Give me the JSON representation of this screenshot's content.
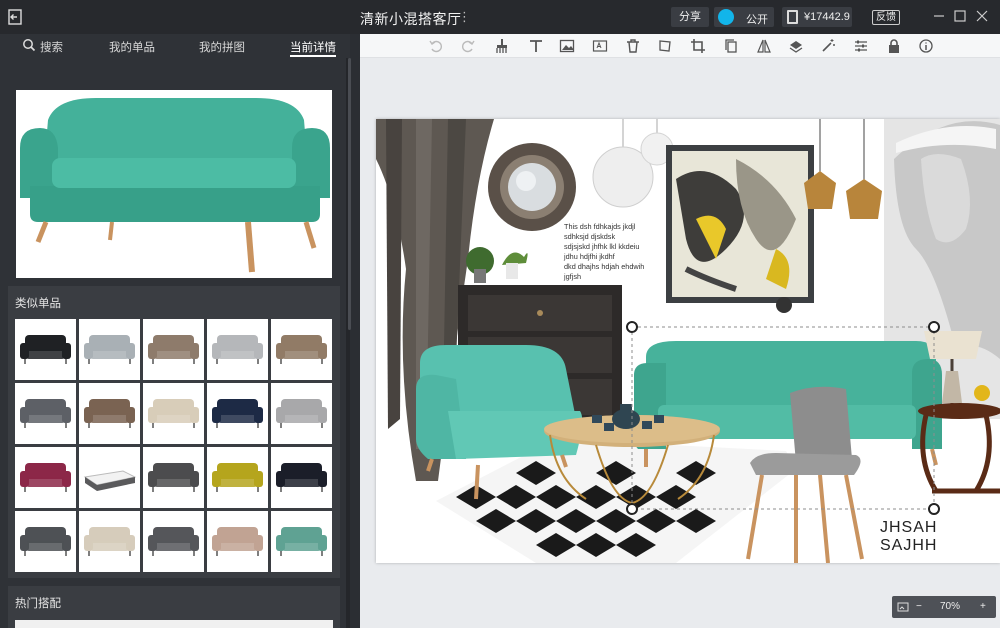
{
  "window": {
    "title": "清新小混搭客厅",
    "more_label": "⋮",
    "share_label": "分享",
    "public_label": "公开",
    "price": "¥17442.9",
    "feedback_label": "反馈"
  },
  "left_panel": {
    "tabs": [
      {
        "label": "搜索",
        "active": false
      },
      {
        "label": "我的单品",
        "active": false
      },
      {
        "label": "我的拼图",
        "active": false
      },
      {
        "label": "当前详情",
        "active": true
      }
    ],
    "similar": {
      "title": "类似单品",
      "items": [
        {
          "icon": "sofa-icon",
          "color": "#1f2124"
        },
        {
          "icon": "sofa-icon",
          "color": "#a9b0b5"
        },
        {
          "icon": "sofa-icon",
          "color": "#8e7b6b"
        },
        {
          "icon": "sofa-icon",
          "color": "#b5b7ba"
        },
        {
          "icon": "sofa-icon",
          "color": "#917b66"
        },
        {
          "icon": "sofa-icon",
          "color": "#5d6066"
        },
        {
          "icon": "sofa-icon",
          "color": "#7a6352"
        },
        {
          "icon": "sofa-icon",
          "color": "#d8cdb9"
        },
        {
          "icon": "sofa-icon",
          "color": "#1d2a45"
        },
        {
          "icon": "sofa-icon",
          "color": "#a8a8aa"
        },
        {
          "icon": "sofa-icon",
          "color": "#8c2748"
        },
        {
          "icon": "bed-icon",
          "color": "#5a5a5c"
        },
        {
          "icon": "sofa-icon",
          "color": "#4c4c4e"
        },
        {
          "icon": "sofa-icon",
          "color": "#b5a51d"
        },
        {
          "icon": "sofa-icon",
          "color": "#1b1e29"
        },
        {
          "icon": "sofa-icon",
          "color": "#4e5155"
        },
        {
          "icon": "sofa-icon",
          "color": "#d6ccbb"
        },
        {
          "icon": "sofa-icon",
          "color": "#55565a"
        },
        {
          "icon": "sofa-icon",
          "color": "#c1a393"
        },
        {
          "icon": "sofa-icon",
          "color": "#5fa293"
        }
      ]
    },
    "hot": {
      "title": "热门搭配"
    }
  },
  "canvas": {
    "moodboard_text": [
      "This dsh  fdhkajds  jkdjl",
      "sdhksjd  djskdsk",
      "sdjsjskd jhfhk lkl kkdeiu",
      "jdhu  hdjfhi  jkdhf",
      "dkd  dhajhs  hdjah  ehdwih",
      "jgfjsh"
    ],
    "signature": "JHSAH  SAJHH",
    "zoom_label": "70%",
    "zoom_minus": "−",
    "zoom_plus": "+"
  },
  "colors": {
    "accent": "#12b5ea",
    "sofa": "#48b39c",
    "titlebar_bg": "#27292d",
    "panel_bg": "#2f3237"
  }
}
